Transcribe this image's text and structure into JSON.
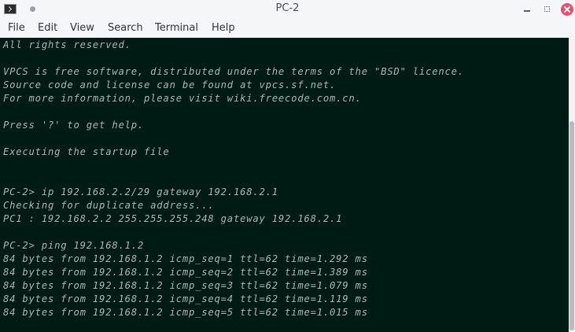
{
  "window": {
    "title": "PC-2"
  },
  "menu": {
    "items": [
      "File",
      "Edit",
      "View",
      "Search",
      "Terminal",
      "Help"
    ]
  },
  "terminal": {
    "lines": [
      "All rights reserved.",
      "",
      "VPCS is free software, distributed under the terms of the \"BSD\" licence.",
      "Source code and license can be found at vpcs.sf.net.",
      "For more information, please visit wiki.freecode.com.cn.",
      "",
      "Press '?' to get help.",
      "",
      "Executing the startup file",
      "",
      "",
      "PC-2> ip 192.168.2.2/29 gateway 192.168.2.1",
      "Checking for duplicate address...",
      "PC1 : 192.168.2.2 255.255.255.248 gateway 192.168.2.1",
      "",
      "PC-2> ping 192.168.1.2",
      "84 bytes from 192.168.1.2 icmp_seq=1 ttl=62 time=1.292 ms",
      "84 bytes from 192.168.1.2 icmp_seq=2 ttl=62 time=1.389 ms",
      "84 bytes from 192.168.1.2 icmp_seq=3 ttl=62 time=1.079 ms",
      "84 bytes from 192.168.1.2 icmp_seq=4 ttl=62 time=1.119 ms",
      "84 bytes from 192.168.1.2 icmp_seq=5 ttl=62 time=1.015 ms"
    ],
    "background": "#001b14",
    "foreground": "#a9b7b1"
  },
  "colors": {
    "close_button": "#e9506f",
    "chrome": "#f5f6f7"
  },
  "icons": {
    "app": "terminal-icon",
    "menu_dot": "window-menu-dot-icon",
    "minimize": "minimize-icon",
    "maximize": "maximize-icon",
    "close": "close-icon"
  }
}
